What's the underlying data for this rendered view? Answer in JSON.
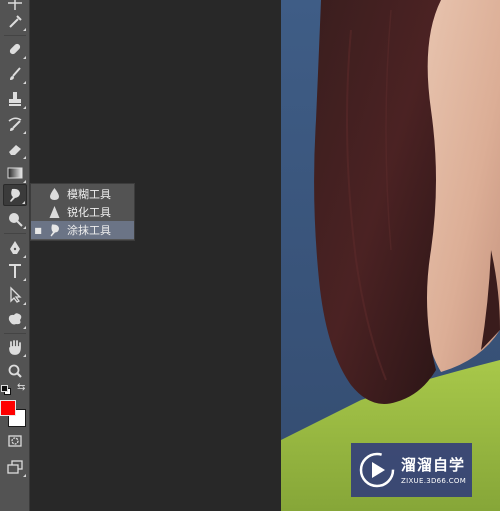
{
  "toolbar": {
    "active_tool": "smudge-tool",
    "foreground_color": "#ff0000",
    "background_color": "#ffffff",
    "tools": [
      "move-tool",
      "eyedropper-tool",
      "healing-brush-tool",
      "brush-tool",
      "clone-stamp-tool",
      "history-brush-tool",
      "eraser-tool",
      "gradient-tool",
      "smudge-tool",
      "dodge-tool",
      "pen-tool",
      "type-tool",
      "path-selection-tool",
      "custom-shape-tool",
      "hand-tool",
      "zoom-tool"
    ]
  },
  "flyout": {
    "items": [
      {
        "label": "模糊工具",
        "icon": "blur-drop-icon",
        "selected": false
      },
      {
        "label": "锐化工具",
        "icon": "sharpen-triangle-icon",
        "selected": false
      },
      {
        "label": "涂抹工具",
        "icon": "smudge-finger-icon",
        "selected": true
      }
    ]
  },
  "watermark": {
    "name": "溜溜自学",
    "url": "ZIXUE.3D66.COM"
  },
  "colors": {
    "panel": "#535353",
    "workspace": "#282828",
    "selection": "#6b7486"
  }
}
